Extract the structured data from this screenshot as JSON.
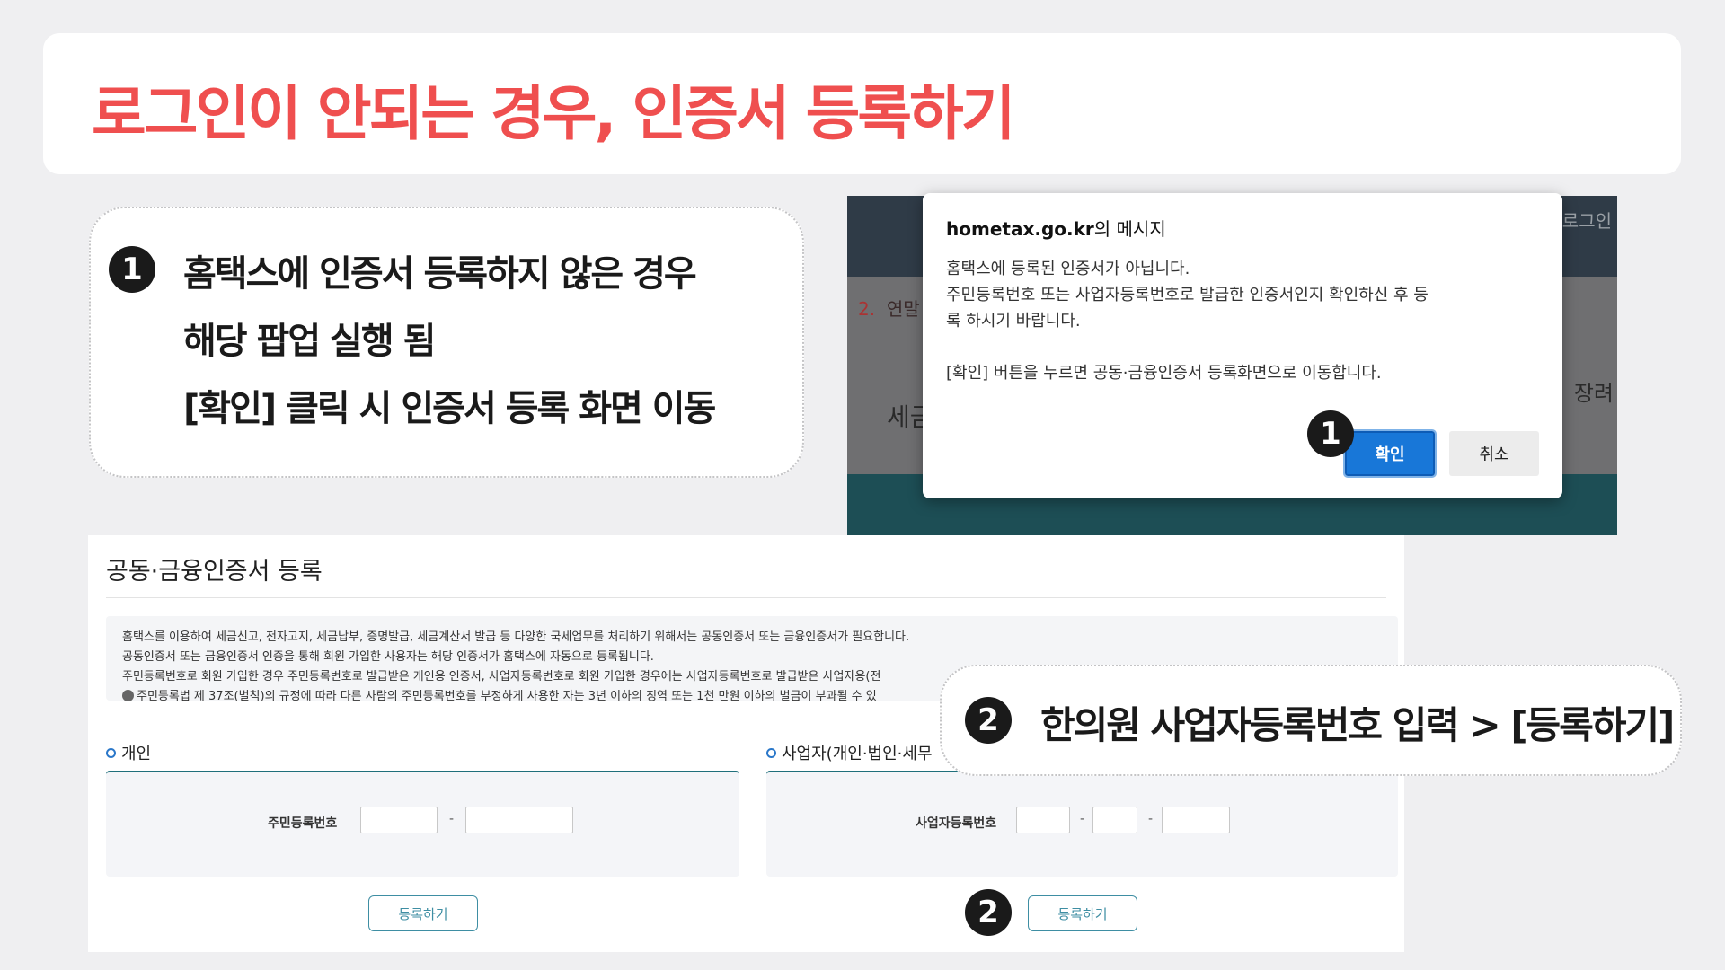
{
  "title": "로그인이 안되는 경우,  인증서 등록하기",
  "step1": {
    "number": "1",
    "line1": "홈택스에 인증서 등록하지 않은 경우",
    "line2": "해당 팝업 실행 됨",
    "line3": "[확인] 클릭 시 인증서 등록 화면 이동"
  },
  "background_site": {
    "login_fragment": "로그인",
    "step_number": "2.",
    "step_fragment": "연말",
    "left_fragment": "세금",
    "right_fragment": "장려"
  },
  "dialog": {
    "title_domain": "hometax.go.kr",
    "title_rest": "의 메시지",
    "msg1": "홈택스에 등록된 인증서가 아닙니다.",
    "msg2": "주민등록번호 또는 사업자등록번호로 발급한 인증서인지 확인하신 후 등",
    "msg3": "록 하시기 바랍니다.",
    "msg4": "[확인] 버튼을 누르면 공동·금융인증서 등록화면으로 이동합니다.",
    "ok_label": "확인",
    "cancel_label": "취소",
    "badge": "1"
  },
  "registration": {
    "title": "공동·금융인증서 등록",
    "info1": "홈택스를 이용하여 세금신고, 전자고지, 세금납부, 증명발급, 세금계산서 발급 등 다양한 국세업무를 처리하기 위해서는 공동인증서 또는 금융인증서가 필요합니다.",
    "info2": "공동인증서 또는 금융인증서 인증을 통해 회원 가입한 사용자는 해당 인증서가 홈택스에 자동으로 등록됩니다.",
    "info3": "주민등록번호로 회원 가입한 경우 주민등록번호로 발급받은 개인용 인증서, 사업자등록번호로 회원 가입한 경우에는 사업자등록번호로 발급받은 사업자용(전",
    "info4": "주민등록법 제 37조(벌칙)의 규정에 따라 다른 사람의 주민등록번호를 부정하게 사용한 자는 3년 이하의 징역 또는 1천 만원 이하의 벌금이 부과될 수 있",
    "personal": {
      "label": "개인",
      "field_label": "주민등록번호",
      "separator": "-",
      "button": "등록하기"
    },
    "business": {
      "label": "사업자(개인·법인·세무",
      "field_label": "사업자등록번호",
      "separator": "-",
      "button": "등록하기"
    }
  },
  "step2": {
    "number": "2",
    "text": "한의원 사업자등록번호 입력 > [등록하기]"
  },
  "colors": {
    "title_red": "#ef4f4f",
    "ok_blue": "#1877d8",
    "teal": "#3e8ea3"
  }
}
